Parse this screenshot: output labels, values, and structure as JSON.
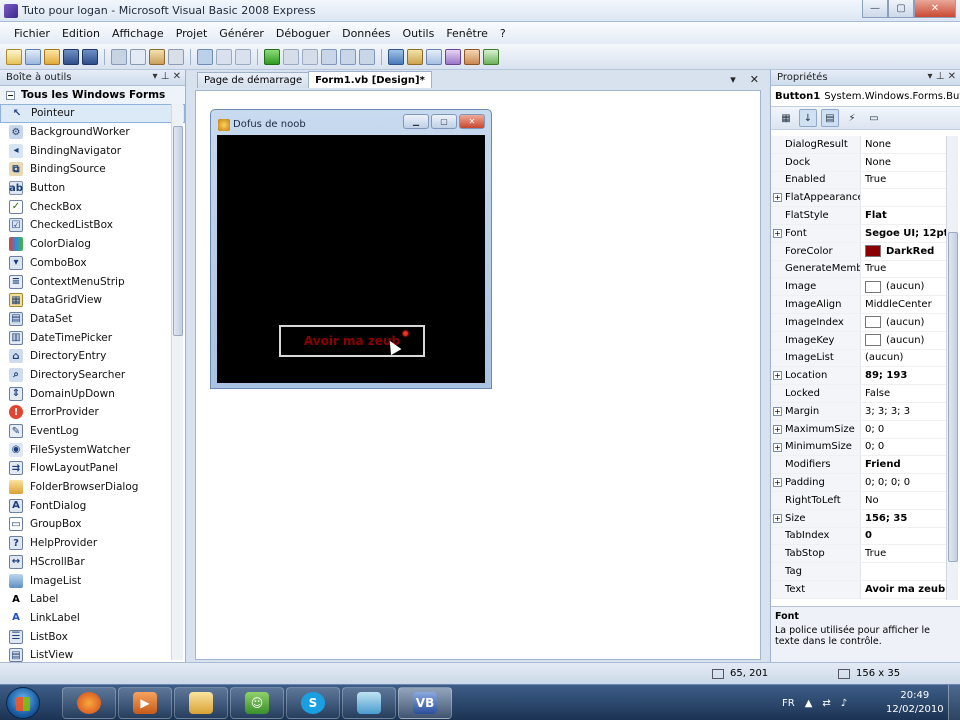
{
  "window": {
    "title": "Tuto pour logan - Microsoft Visual Basic 2008 Express",
    "minimize": "—",
    "maximize": "▢",
    "close": "✕"
  },
  "menu": [
    "Fichier",
    "Edition",
    "Affichage",
    "Projet",
    "Générer",
    "Déboguer",
    "Données",
    "Outils",
    "Fenêtre",
    "?"
  ],
  "toolbox": {
    "title": "Boîte à outils",
    "pin": "▾ ⊥ ✕",
    "section": "Tous les Windows Forms",
    "items": [
      "Pointeur",
      "BackgroundWorker",
      "BindingNavigator",
      "BindingSource",
      "Button",
      "CheckBox",
      "CheckedListBox",
      "ColorDialog",
      "ComboBox",
      "ContextMenuStrip",
      "DataGridView",
      "DataSet",
      "DateTimePicker",
      "DirectoryEntry",
      "DirectorySearcher",
      "DomainUpDown",
      "ErrorProvider",
      "EventLog",
      "FileSystemWatcher",
      "FlowLayoutPanel",
      "FolderBrowserDialog",
      "FontDialog",
      "GroupBox",
      "HelpProvider",
      "HScrollBar",
      "ImageList",
      "Label",
      "LinkLabel",
      "ListBox",
      "ListView"
    ]
  },
  "tabs": [
    {
      "label": "Page de démarrage",
      "active": false
    },
    {
      "label": "Form1.vb [Design]*",
      "active": true
    }
  ],
  "doc_buttons": {
    "dropdown": "▾",
    "close": "✕"
  },
  "form": {
    "title": "Dofus de noob",
    "button_text": "Avoir ma zeub"
  },
  "properties": {
    "title": "Propriétés",
    "pin": "▾ ⊥ ✕",
    "object_name": "Button1",
    "object_type": "System.Windows.Forms.Button",
    "rows": [
      {
        "name": "DialogResult",
        "value": "None",
        "expand": false,
        "bold": false
      },
      {
        "name": "Dock",
        "value": "None",
        "expand": false,
        "bold": false
      },
      {
        "name": "Enabled",
        "value": "True",
        "expand": false,
        "bold": false
      },
      {
        "name": "FlatAppearance",
        "value": "",
        "expand": true,
        "bold": false
      },
      {
        "name": "FlatStyle",
        "value": "Flat",
        "expand": false,
        "bold": true
      },
      {
        "name": "Font",
        "value": "Segoe UI; 12pt",
        "expand": true,
        "bold": true
      },
      {
        "name": "ForeColor",
        "value": "DarkRed",
        "expand": false,
        "bold": true,
        "swatch": "#8b0000"
      },
      {
        "name": "GenerateMember",
        "value": "True",
        "expand": false,
        "bold": false
      },
      {
        "name": "Image",
        "value": "(aucun)",
        "expand": false,
        "bold": false,
        "swatch": "#ffffff"
      },
      {
        "name": "ImageAlign",
        "value": "MiddleCenter",
        "expand": false,
        "bold": false
      },
      {
        "name": "ImageIndex",
        "value": "(aucun)",
        "expand": false,
        "bold": false,
        "swatch": "#ffffff"
      },
      {
        "name": "ImageKey",
        "value": "(aucun)",
        "expand": false,
        "bold": false,
        "swatch": "#ffffff"
      },
      {
        "name": "ImageList",
        "value": "(aucun)",
        "expand": false,
        "bold": false
      },
      {
        "name": "Location",
        "value": "89; 193",
        "expand": true,
        "bold": true
      },
      {
        "name": "Locked",
        "value": "False",
        "expand": false,
        "bold": false
      },
      {
        "name": "Margin",
        "value": "3; 3; 3; 3",
        "expand": true,
        "bold": false
      },
      {
        "name": "MaximumSize",
        "value": "0; 0",
        "expand": true,
        "bold": false
      },
      {
        "name": "MinimumSize",
        "value": "0; 0",
        "expand": true,
        "bold": false
      },
      {
        "name": "Modifiers",
        "value": "Friend",
        "expand": false,
        "bold": true
      },
      {
        "name": "Padding",
        "value": "0; 0; 0; 0",
        "expand": true,
        "bold": false
      },
      {
        "name": "RightToLeft",
        "value": "No",
        "expand": false,
        "bold": false
      },
      {
        "name": "Size",
        "value": "156; 35",
        "expand": true,
        "bold": true
      },
      {
        "name": "TabIndex",
        "value": "0",
        "expand": false,
        "bold": true
      },
      {
        "name": "TabStop",
        "value": "True",
        "expand": false,
        "bold": false
      },
      {
        "name": "Tag",
        "value": "",
        "expand": false,
        "bold": false
      },
      {
        "name": "Text",
        "value": "Avoir ma zeub",
        "expand": false,
        "bold": true
      }
    ],
    "description_title": "Font",
    "description_text": "La police utilisée pour afficher le texte dans le contrôle."
  },
  "status": {
    "position": "65, 201",
    "size": "156 x 35"
  },
  "taskbar": {
    "language": "FR",
    "time": "20:49",
    "date": "12/02/2010"
  }
}
